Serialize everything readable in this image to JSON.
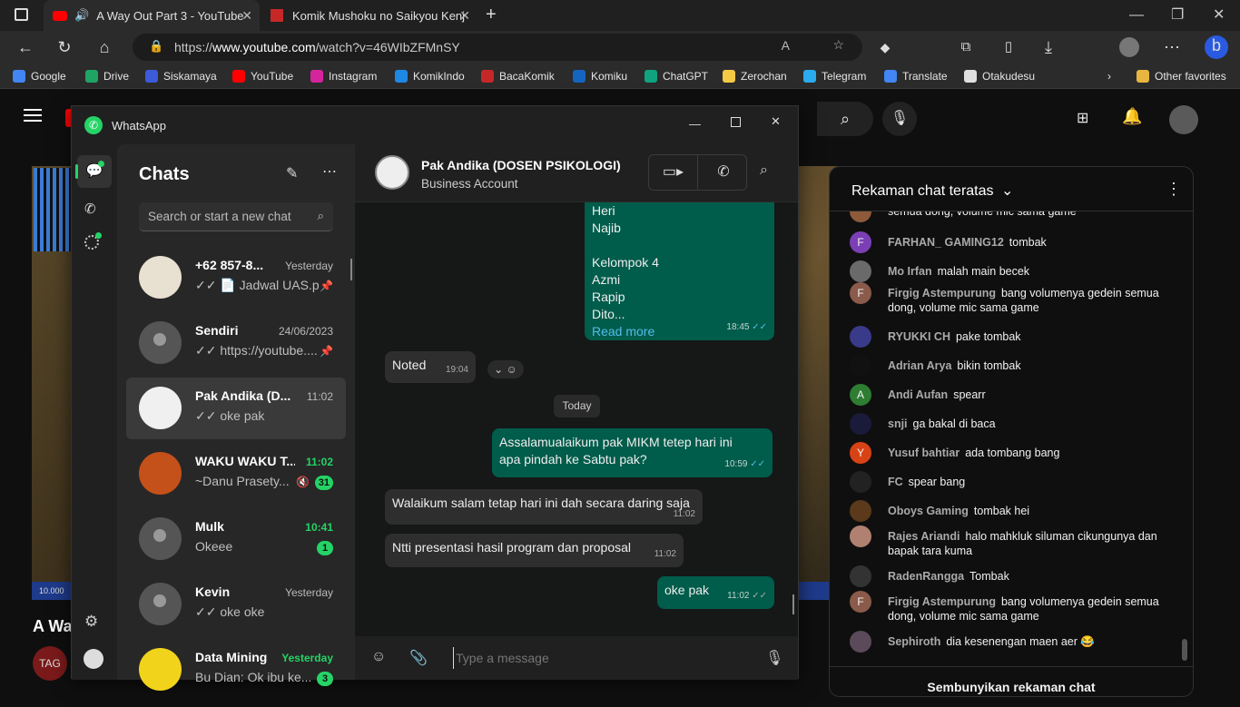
{
  "browser": {
    "tabs": [
      {
        "title": "A Way Out Part 3 - YouTube"
      },
      {
        "title": "Komik Mushoku no Saikyou Kenj"
      }
    ],
    "url_prefix": "https://",
    "url_host": "www.youtube.com",
    "url_path": "/watch?v=46WIbZFMnSY",
    "bookmarks": [
      {
        "label": "Google",
        "color": "#4285f4"
      },
      {
        "label": "Drive",
        "color": "#1fa463"
      },
      {
        "label": "Siskamaya",
        "color": "#3b5bdb"
      },
      {
        "label": "YouTube",
        "color": "#ff0000"
      },
      {
        "label": "Instagram",
        "color": "#d6249f"
      },
      {
        "label": "KomikIndo",
        "color": "#1e88e5"
      },
      {
        "label": "BacaKomik",
        "color": "#c62828"
      },
      {
        "label": "Komiku",
        "color": "#1565c0"
      },
      {
        "label": "ChatGPT",
        "color": "#10a37f"
      },
      {
        "label": "Zerochan",
        "color": "#f6c945"
      },
      {
        "label": "Telegram",
        "color": "#2aabee"
      },
      {
        "label": "Translate",
        "color": "#4285f4"
      },
      {
        "label": "Otakudesu",
        "color": "#e0e0e0"
      }
    ],
    "other_favorites": "Other favorites"
  },
  "youtube": {
    "video_title_partial": "A Wa",
    "views_partial": "10.000",
    "live_chat": {
      "header": "Rekaman chat teratas",
      "footer": "Sembunyikan rekaman chat",
      "messages": [
        {
          "name": "",
          "text": "semua dong, volume mic sama game",
          "avatar_color": "#8e5a3a"
        },
        {
          "name": "FARHAN_ GAMING12",
          "text": "tombak",
          "avatar_color": "#7b3fb5",
          "initial": "F"
        },
        {
          "name": "Mo Irfan",
          "text": "malah main becek",
          "avatar_color": "#6a6a6a"
        },
        {
          "name": "Firgig Astempurung",
          "text": "bang volumenya gedein semua dong, volume mic sama game",
          "avatar_color": "#8a5a4a",
          "initial": "F"
        },
        {
          "name": "RYUKKI CH",
          "text": "pake tombak",
          "avatar_color": "#3a3a8a"
        },
        {
          "name": "Adrian Arya",
          "text": "bikin tombak",
          "avatar_color": "#111111"
        },
        {
          "name": "Andi Aufan",
          "text": "spearr",
          "avatar_color": "#2e7d32",
          "initial": "A"
        },
        {
          "name": "snji",
          "text": "ga bakal di baca",
          "avatar_color": "#1a1a3a"
        },
        {
          "name": "Yusuf bahtiar",
          "text": "ada tombang bang",
          "avatar_color": "#d84315",
          "initial": "Y"
        },
        {
          "name": "FC",
          "text": "spear bang",
          "avatar_color": "#222222"
        },
        {
          "name": "Oboys Gaming",
          "text": "tombak hei",
          "avatar_color": "#5a3a1a"
        },
        {
          "name": "Rajes Ariandi",
          "text": "halo mahkluk siluman cikungunya dan bapak tara kuma",
          "avatar_color": "#b08070"
        },
        {
          "name": "RadenRangga",
          "text": "Tombak",
          "avatar_color": "#333333"
        },
        {
          "name": "Firgig Astempurung",
          "text": "bang volumenya gedein semua dong, volume mic sama game",
          "avatar_color": "#8a5a4a",
          "initial": "F"
        },
        {
          "name": "Sephiroth",
          "text": "dia kesenengan maen aer 😂",
          "avatar_color": "#5a4a5a"
        }
      ]
    }
  },
  "whatsapp": {
    "app_title": "WhatsApp",
    "chats_title": "Chats",
    "search_placeholder": "Search or start a new chat",
    "chats": [
      {
        "name": "+62 857-8...",
        "time": "Yesterday",
        "preview": "✓✓ 📄 Jadwal UAS.p...",
        "icon": "pin"
      },
      {
        "name": "Sendiri",
        "time": "24/06/2023",
        "preview": "✓✓ https://youtube....",
        "icon": "pin"
      },
      {
        "name": "Pak Andika (D...",
        "time": "11:02",
        "preview": "✓✓ oke pak",
        "icon": ""
      },
      {
        "name": "WAKU WAKU T...",
        "time": "11:02",
        "preview": "~Danu Praset​y...",
        "badge": "31",
        "icon": "mute"
      },
      {
        "name": "Mulk",
        "time": "10:41",
        "preview": "Okeee",
        "badge": "1"
      },
      {
        "name": "Kevin",
        "time": "Yesterday",
        "preview": "✓✓ oke oke"
      },
      {
        "name": "Data Mining",
        "time": "Yesterday",
        "preview": "Bu Dian: Ok ibu ke...",
        "badge": "3"
      }
    ],
    "contact": {
      "name": "Pak Andika (DOSEN PSIKOLOGI)",
      "subtitle": "Business Account"
    },
    "messages": {
      "m1": {
        "lines": [
          "Heri",
          "Najib",
          "",
          "Kelompok 4",
          "Azmi",
          "Rapip",
          "Dito..."
        ],
        "read_more": "Read more",
        "time": "18:45"
      },
      "m2": {
        "text": "Noted",
        "time": "19:04"
      },
      "day": "Today",
      "m3": {
        "text": "Assalamualaikum pak MIKM tetep hari ini apa pindah ke Sabtu pak?",
        "time": "10:59"
      },
      "m4": {
        "text": "Walaikum salam tetap hari ini dah secara daring saja",
        "time": "11:02"
      },
      "m5": {
        "text": "Ntti presentasi hasil program dan proposal",
        "time": "11:02"
      },
      "m6": {
        "text": "oke pak",
        "time": "11:02"
      }
    },
    "composer_placeholder": "Type a message"
  },
  "colors": {
    "wa_green": "#25d366",
    "out_bubble": "#005c4b",
    "in_bubble": "#2e2e2e"
  }
}
